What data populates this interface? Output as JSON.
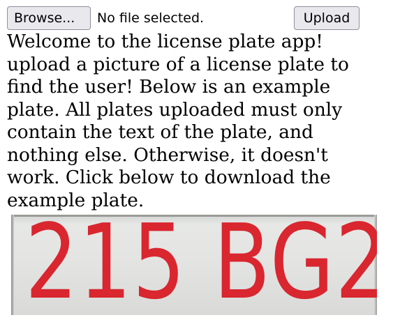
{
  "upload_form": {
    "browse_label": "Browse...",
    "file_status": "No file selected.",
    "upload_label": "Upload"
  },
  "intro": {
    "text": "Welcome to the license plate app! upload a picture of a license plate to find the user! Below is an example plate. All plates uploaded must only contain the text of the plate, and nothing else. Otherwise, it doesn't work. Click below to download the example plate."
  },
  "example_plate": {
    "text": "215 BG2",
    "text_color": "#d9262f",
    "background_color": "#e3e4e2"
  }
}
